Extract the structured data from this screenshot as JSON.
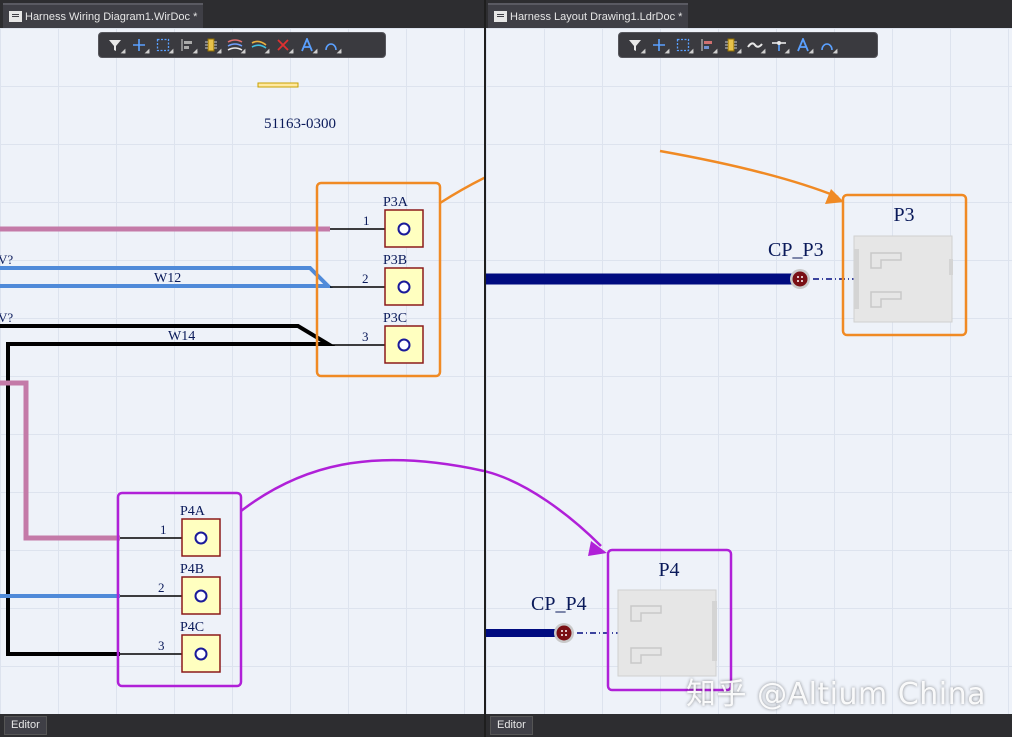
{
  "left_pane": {
    "tab_label": "Harness Wiring Diagram1.WirDoc *",
    "status_label": "Editor",
    "part_number": "51163-0300",
    "connector_p3": {
      "pins": [
        {
          "name": "P3A",
          "number": "1"
        },
        {
          "name": "P3B",
          "number": "2"
        },
        {
          "name": "P3C",
          "number": "3"
        }
      ]
    },
    "connector_p4": {
      "pins": [
        {
          "name": "P4A",
          "number": "1"
        },
        {
          "name": "P4B",
          "number": "2"
        },
        {
          "name": "P4C",
          "number": "3"
        }
      ]
    },
    "wires": [
      {
        "label": "W12",
        "stub": "V?"
      },
      {
        "label": "W14",
        "stub": "V?"
      }
    ],
    "toolbar_icons": [
      "filter-icon",
      "cross-icon",
      "select-rect-icon",
      "align-icon",
      "component-icon",
      "wire-icon",
      "cable-icon",
      "no-connect-icon",
      "text-icon",
      "arc-icon"
    ]
  },
  "right_pane": {
    "tab_label": "Harness Layout Drawing1.LdrDoc *",
    "status_label": "Editor",
    "connector_p3": {
      "designator": "P3",
      "connection_point": "CP_P3"
    },
    "connector_p4": {
      "designator": "P4",
      "connection_point": "CP_P4"
    },
    "toolbar_icons": [
      "filter-icon",
      "cross-icon",
      "select-rect-icon",
      "align-icon",
      "component-icon",
      "wire-icon",
      "connection-point-icon",
      "text-icon",
      "arc-icon"
    ]
  },
  "watermark": "知乎 @Altium China",
  "colors": {
    "p3_highlight": "#f08a24",
    "p4_highlight": "#b020d8",
    "wire_pink": "#c47aa8",
    "wire_blue": "#4f8ad9",
    "wire_black": "#000000",
    "bundle_navy": "#000b80",
    "pin_fill": "#ffffc0",
    "pin_border": "#8b1a1a",
    "canvas_bg": "#eef2f9"
  }
}
